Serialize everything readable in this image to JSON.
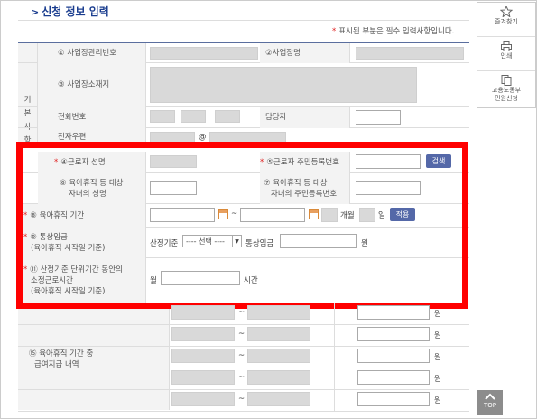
{
  "page_title": "신청 정보 입력",
  "notice": "표시된 부분은 필수 입력사항입니다.",
  "notice_star": "*",
  "sidebar": {
    "favorites": "즐겨찾기",
    "print": "인쇄",
    "civil_line1": "고용노동부",
    "civil_line2": "민원신청"
  },
  "basic_header": [
    "기",
    "본",
    "사",
    "항"
  ],
  "fields": {
    "biz_reg_no": "① 사업장관리번호",
    "biz_name": "②사업장명",
    "biz_address": "③ 사업장소재지",
    "phone": "전화번호",
    "manager": "담당자",
    "email": "전자우편",
    "email_at": "@",
    "worker_name": "④근로자 성명",
    "worker_rrn": "⑤근로자 주민등록번호",
    "search_btn": "검색",
    "child_name_l1": "⑥ 육아휴직 등 대상",
    "child_name_l2": "자녀의 성명",
    "child_rrn_l1": "⑦ 육아휴직 등 대상",
    "child_rrn_l2": "자녀의 주민등록번호",
    "leave_period": "⑧ 육아휴직 기간",
    "tilde": "~",
    "months": "개월",
    "days": "일",
    "apply_btn": "적용",
    "wage_l1": "⑨ 통상임금",
    "wage_l2": "(육아휴직 시작일 기준)",
    "calc_basis": "산정기준",
    "select_value": "---- 선택 ----",
    "wage_label": "통상임금",
    "won": "원",
    "hours_l1": "⑪ 산정기준 단위기간 동안의",
    "hours_l2": "소정근로시간",
    "hours_l3": "(육아휴직 시작일 기준)",
    "month_label": "월",
    "hours_unit": "시간",
    "pay_l1": "⑮ 육아휴직 기간 중",
    "pay_l2": "급여지급 내역"
  },
  "required_mark": "*",
  "top_button": "TOP",
  "pay_rows": 5
}
